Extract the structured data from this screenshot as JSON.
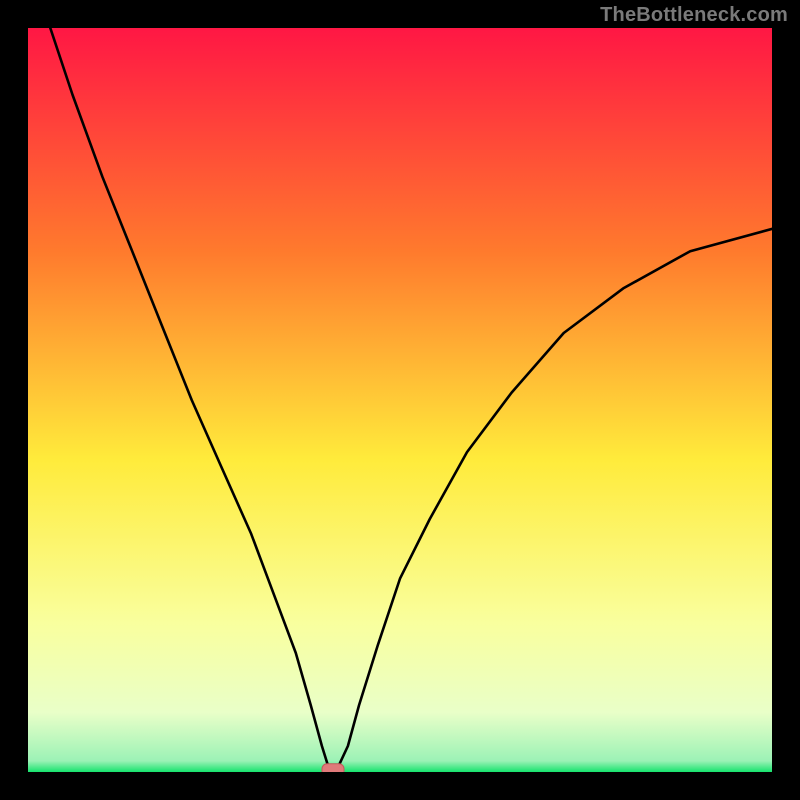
{
  "watermark": "TheBottleneck.com",
  "colors": {
    "frame_border": "#000000",
    "gradient_top": "#ff1744",
    "gradient_upper_mid": "#ff7a2d",
    "gradient_mid": "#ffeb3b",
    "gradient_lower_mid": "#f5ffa9",
    "gradient_near_bottom": "#d9ffcf",
    "gradient_bottom": "#16e36d",
    "curve_stroke": "#000000",
    "marker_fill": "#e07a7a",
    "marker_stroke": "#c45a5a"
  },
  "chart_data": {
    "type": "line",
    "title": "",
    "xlabel": "",
    "ylabel": "",
    "xlim": [
      0,
      100
    ],
    "ylim": [
      0,
      100
    ],
    "categories_note": "no axis tick labels; values inferred from geometry",
    "series": [
      {
        "name": "bottleneck-curve",
        "x": [
          3,
          6,
          10,
          14,
          18,
          22,
          26,
          30,
          33,
          36,
          38,
          39.5,
          40.5,
          41.5,
          43,
          44.5,
          47,
          50,
          54,
          59,
          65,
          72,
          80,
          89,
          100
        ],
        "y": [
          100,
          91,
          80,
          70,
          60,
          50,
          41,
          32,
          24,
          16,
          9,
          3.5,
          0.3,
          0.3,
          3.5,
          9,
          17,
          26,
          34,
          43,
          51,
          59,
          65,
          70,
          73
        ]
      }
    ],
    "marker": {
      "x": 41,
      "y": 0.3,
      "shape": "rounded-rect"
    },
    "background_gradient": {
      "direction": "vertical",
      "stops": [
        {
          "pos": 0.0,
          "color": "#ff1744"
        },
        {
          "pos": 0.3,
          "color": "#ff7a2d"
        },
        {
          "pos": 0.58,
          "color": "#ffeb3b"
        },
        {
          "pos": 0.8,
          "color": "#f9ff9e"
        },
        {
          "pos": 0.92,
          "color": "#e9ffc8"
        },
        {
          "pos": 0.985,
          "color": "#9cf2b6"
        },
        {
          "pos": 1.0,
          "color": "#16e36d"
        }
      ]
    }
  }
}
